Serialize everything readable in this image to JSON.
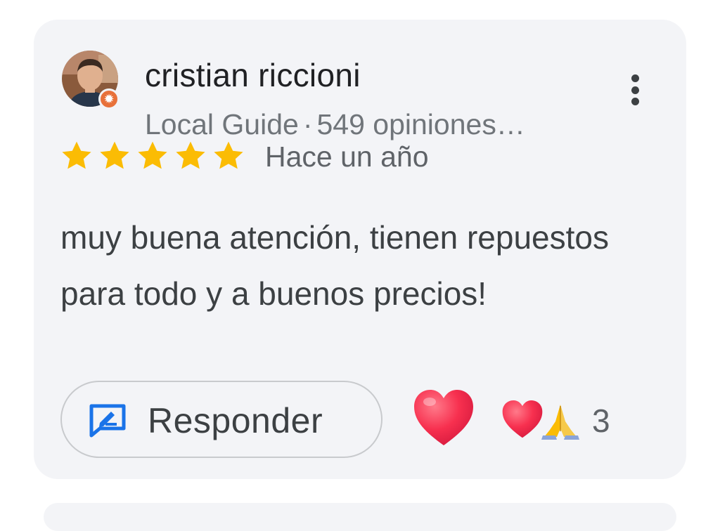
{
  "review": {
    "author": {
      "name": "cristian riccioni",
      "badge": "Local Guide",
      "separator": "·",
      "reviews_count": "549 opiniones…",
      "avatar_icon": "person-avatar",
      "badge_icon": "local-guide-star-icon"
    },
    "rating": {
      "stars": 5,
      "max": 5,
      "color": "#fbbc04"
    },
    "time": "Hace un año",
    "text": "muy buena atención, tienen repuestos para todo y a buenos precios!",
    "actions": {
      "reply_label": "Responder",
      "reply_icon": "reply-icon",
      "react_icon": "heart-icon",
      "more_icon": "more-vert-icon"
    },
    "reactions": {
      "icons": [
        "heart-icon",
        "folded-hands-icon"
      ],
      "count": "3"
    }
  },
  "colors": {
    "card_background": "#f3f4f7",
    "accent_blue": "#1a73e8",
    "badge_orange": "#e8713a",
    "heart_red": "#f0284a"
  }
}
